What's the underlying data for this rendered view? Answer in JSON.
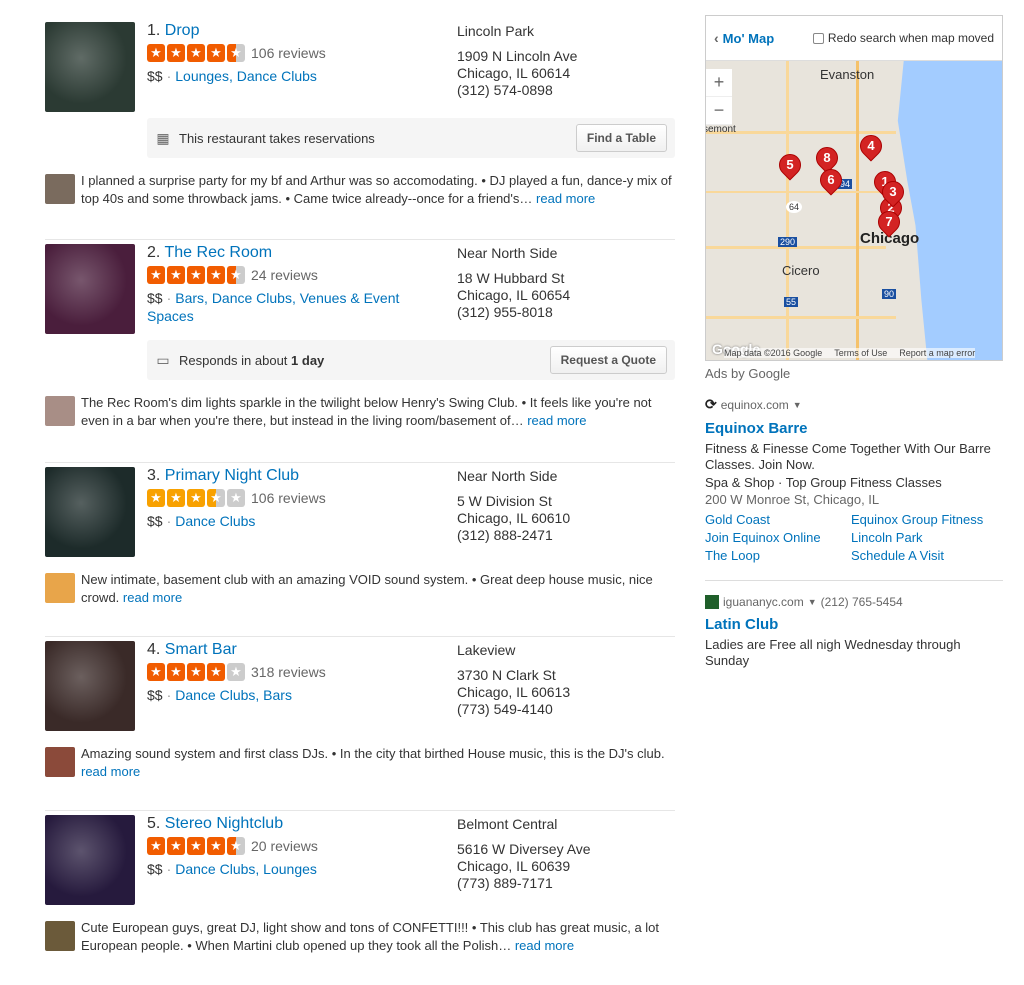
{
  "results": [
    {
      "num": "1.",
      "name": "Drop",
      "stars": [
        1,
        1,
        1,
        1,
        0.5
      ],
      "reviews": "106 reviews",
      "price": "$$",
      "categories": "Lounges, Dance Clubs",
      "hood": "Lincoln Park",
      "street": "1909 N Lincoln Ave",
      "city": "Chicago, IL 60614",
      "phone": "(312) 574-0898",
      "action": {
        "icon": "calendar-icon",
        "text": "This restaurant takes reservations",
        "bold": "",
        "button": "Find a Table"
      },
      "snippet": "I planned a surprise party for my bf and Arthur was so accomodating.  •  DJ played a fun, dance-y mix of top 40s and some throwback jams.  •  Came twice already--once for a friend's…",
      "read_more": "read more",
      "thumb_color": "#2b3a33",
      "avatar_color": "#7a6b5e"
    },
    {
      "num": "2.",
      "name": "The Rec Room",
      "stars": [
        1,
        1,
        1,
        1,
        0.5
      ],
      "reviews": "24 reviews",
      "price": "$$",
      "categories": "Bars, Dance Clubs, Venues & Event Spaces",
      "hood": "Near North Side",
      "street": "18 W Hubbard St",
      "city": "Chicago, IL 60654",
      "phone": "(312) 955-8018",
      "action": {
        "icon": "chat-bubble-icon",
        "text": "Responds in about ",
        "bold": "1 day",
        "button": "Request a Quote"
      },
      "snippet": "The Rec Room's dim lights sparkle in the twilight below Henry's Swing Club.  •  It feels like you're not even in a bar when you're there, but instead in the living room/basement of…",
      "read_more": "read more",
      "thumb_color": "#4a1e3c",
      "avatar_color": "#a88e86"
    },
    {
      "num": "3.",
      "name": "Primary Night Club",
      "stars": [
        1,
        1,
        1,
        0.5,
        0
      ],
      "reviews": "106 reviews",
      "price": "$$",
      "categories": "Dance Clubs",
      "hood": "Near North Side",
      "street": "5 W Division St",
      "city": "Chicago, IL 60610",
      "phone": "(312) 888-2471",
      "snippet": "New intimate, basement club with an amazing VOID sound system.  •  Great deep house music, nice crowd.",
      "read_more": "read more",
      "thumb_color": "#1d2b2a",
      "avatar_color": "#e8a54a"
    },
    {
      "num": "4.",
      "name": "Smart Bar",
      "stars": [
        1,
        1,
        1,
        1,
        0
      ],
      "reviews": "318 reviews",
      "price": "$$",
      "categories": "Dance Clubs, Bars",
      "hood": "Lakeview",
      "street": "3730 N Clark St",
      "city": "Chicago, IL 60613",
      "phone": "(773) 549-4140",
      "snippet": "Amazing sound system and first class DJs.  •  In the city that birthed House music, this is the DJ's club.",
      "read_more": "read more",
      "thumb_color": "#3a2a28",
      "avatar_color": "#8b4a3a"
    },
    {
      "num": "5.",
      "name": "Stereo Nightclub",
      "stars": [
        1,
        1,
        1,
        1,
        0.5
      ],
      "reviews": "20 reviews",
      "price": "$$",
      "categories": "Dance Clubs, Lounges",
      "hood": "Belmont Central",
      "street": "5616 W Diversey Ave",
      "city": "Chicago, IL 60639",
      "phone": "(773) 889-7171",
      "snippet": "Cute European guys, great DJ, light show and tons of CONFETTI!!!  •  This club has great music, a lot European people.  •  When Martini club opened up they took all the Polish…",
      "read_more": "read more",
      "thumb_color": "#261a3d",
      "avatar_color": "#6b5a3a"
    }
  ],
  "map": {
    "title": "Mo' Map",
    "redo": "Redo search when map moved",
    "zoom_in": "+",
    "zoom_out": "−",
    "labels": {
      "evanston": "Evanston",
      "chicago": "Chicago",
      "cicero": "Cicero",
      "belmont": "semont"
    },
    "highways": [
      "94",
      "64",
      "290",
      "55",
      "90"
    ],
    "pins": [
      "4",
      "8",
      "5",
      "6",
      "1",
      "2",
      "3",
      "7"
    ],
    "footer": {
      "data": "Map data ©2016 Google",
      "terms": "Terms of Use",
      "report": "Report a map error"
    },
    "watermark": "Google"
  },
  "ads": {
    "label": "Ads by Google",
    "ad1": {
      "domain": "equinox.com",
      "title": "Equinox Barre",
      "body": "Fitness & Finesse Come Together With Our Barre Classes. Join Now.",
      "line2": "Spa & Shop · Top Group Fitness Classes",
      "line3": "200 W Monroe St, Chicago, IL",
      "links": [
        "Gold Coast",
        "Equinox Group Fitness",
        "Join Equinox Online",
        "Lincoln Park",
        "The Loop",
        "Schedule A Visit"
      ]
    },
    "ad2": {
      "domain": "iguananyc.com",
      "phone": "(212) 765-5454",
      "title": "Latin Club",
      "body": "Ladies are Free all nigh Wednesday through Sunday"
    }
  }
}
